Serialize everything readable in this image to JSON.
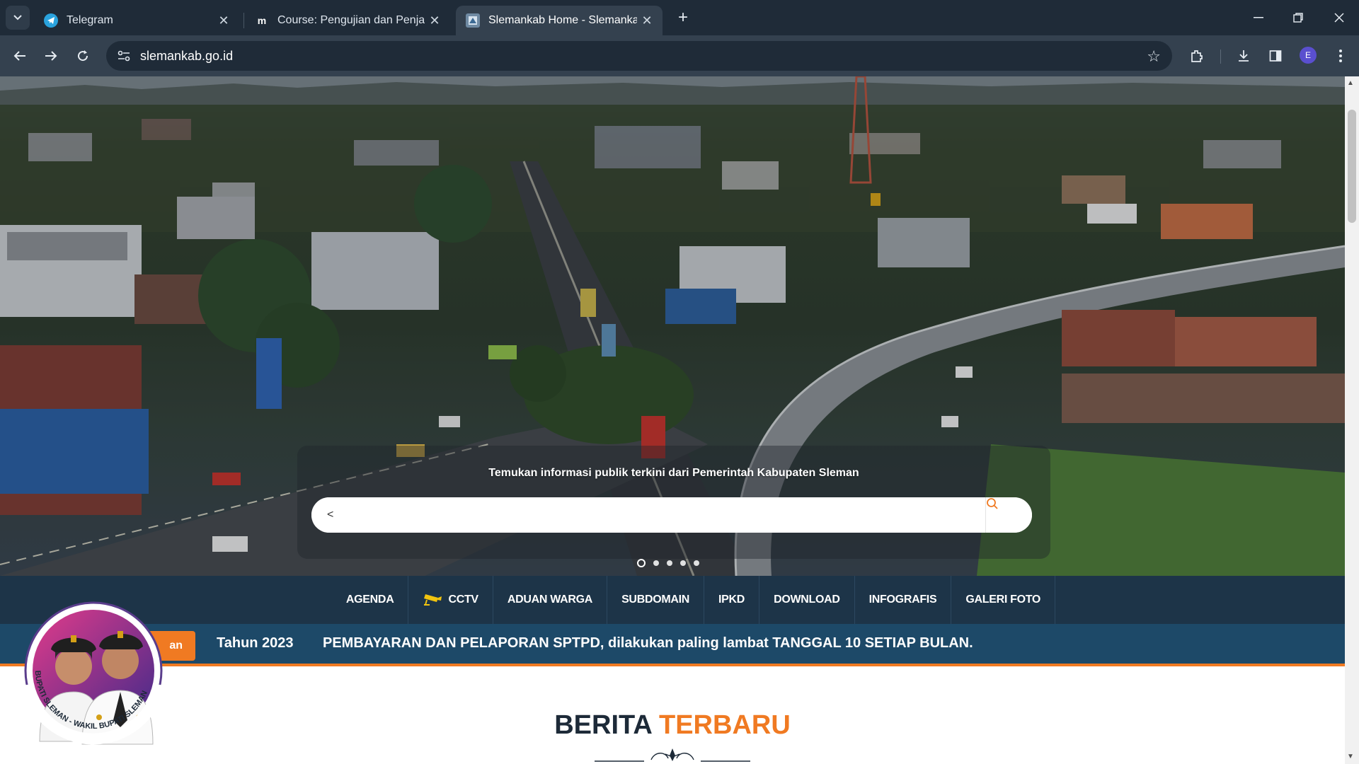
{
  "browser": {
    "tabs": [
      {
        "title": "Telegram",
        "active": false
      },
      {
        "title": "Course: Pengujian dan Penjamin",
        "active": false
      },
      {
        "title": "Slemankab Home - Slemankab",
        "active": true
      }
    ],
    "url": "slemankab.go.id",
    "profile_initial": "E",
    "icons": [
      "tab-search-icon",
      "close-icon",
      "new-tab-icon",
      "minimize-icon",
      "restore-icon",
      "window-close-icon",
      "back-icon",
      "forward-icon",
      "reload-icon",
      "site-info-icon",
      "bookmark-star-icon",
      "extensions-icon",
      "download-icon",
      "side-panel-icon",
      "menu-kebab-icon"
    ]
  },
  "hero": {
    "caption": "Temukan informasi publik terkini dari Pemerintah Kabupaten Sleman",
    "search_value": "<",
    "slide_count": 5,
    "active_slide": 1
  },
  "menu": {
    "items": [
      "AGENDA",
      "CCTV",
      "ADUAN WARGA",
      "SUBDOMAIN",
      "IPKD",
      "DOWNLOAD",
      "INFOGRAFIS",
      "GALERI FOTO"
    ]
  },
  "ticker": {
    "label": "an",
    "prefix": "Tahun 2023",
    "text": "PEMBAYARAN DAN PELAPORAN SPTPD, dilakukan paling lambat TANGGAL 10 SETIAP BULAN."
  },
  "section": {
    "title_main": "BERITA",
    "title_accent": "TERBARU"
  },
  "badge": {
    "ring_text": "BUPATI SLEMAN - WAKIL BUPATI SLEMAN"
  },
  "colors": {
    "menu_bg": "#1d3448",
    "ticker_bg": "#1d4968",
    "accent": "#f07a22",
    "chrome_dark": "#1f2b38",
    "chrome_toolbar": "#34414f"
  }
}
